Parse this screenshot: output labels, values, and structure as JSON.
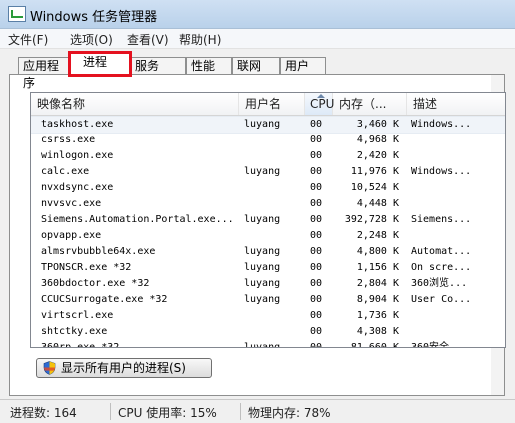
{
  "window": {
    "title": "Windows 任务管理器"
  },
  "menu": [
    {
      "label": "文件(F)"
    },
    {
      "label": "选项(O)"
    },
    {
      "label": "查看(V)"
    },
    {
      "label": "帮助(H)"
    }
  ],
  "tabs": [
    {
      "label": "应用程序"
    },
    {
      "label": "进程",
      "active": true
    },
    {
      "label": "服务"
    },
    {
      "label": "性能"
    },
    {
      "label": "联网"
    },
    {
      "label": "用户"
    }
  ],
  "table": {
    "columns": [
      "映像名称",
      "用户名",
      "CPU",
      "内存（...",
      "描述"
    ],
    "sorted_column": "CPU",
    "rows": [
      [
        "taskhost.exe",
        "luyang",
        "00",
        "3,460 K",
        "Windows..."
      ],
      [
        "csrss.exe",
        "",
        "00",
        "4,968 K",
        ""
      ],
      [
        "winlogon.exe",
        "",
        "00",
        "2,420 K",
        ""
      ],
      [
        "calc.exe",
        "luyang",
        "00",
        "11,976 K",
        "Windows..."
      ],
      [
        "nvxdsync.exe",
        "",
        "00",
        "10,524 K",
        ""
      ],
      [
        "nvvsvc.exe",
        "",
        "00",
        "4,448 K",
        ""
      ],
      [
        "Siemens.Automation.Portal.exe...",
        "luyang",
        "00",
        "392,728 K",
        "Siemens..."
      ],
      [
        "opvapp.exe",
        "",
        "00",
        "2,248 K",
        ""
      ],
      [
        "almsrvbubble64x.exe",
        "luyang",
        "00",
        "4,800 K",
        "Automat..."
      ],
      [
        "TPONSCR.exe *32",
        "luyang",
        "00",
        "1,156 K",
        "On scre..."
      ],
      [
        "360bdoctor.exe *32",
        "luyang",
        "00",
        "2,804 K",
        "360浏览..."
      ],
      [
        "CCUCSurrogate.exe *32",
        "luyang",
        "00",
        "8,904 K",
        "User Co..."
      ],
      [
        "virtscrl.exe",
        "",
        "00",
        "1,736 K",
        ""
      ],
      [
        "shtctky.exe",
        "",
        "00",
        "4,308 K",
        ""
      ],
      [
        "360rp.exe *32",
        "luyang",
        "00",
        "81,660 K",
        "360安全..."
      ]
    ]
  },
  "buttons": {
    "show_all_processes": "显示所有用户的进程(S)"
  },
  "status": {
    "processes": "进程数: 164",
    "cpu": "CPU 使用率: 15%",
    "memory": "物理内存: 78%"
  },
  "colors": {
    "active_tab_highlight": "#e4111f",
    "titlebar": "#b9d1ea"
  }
}
